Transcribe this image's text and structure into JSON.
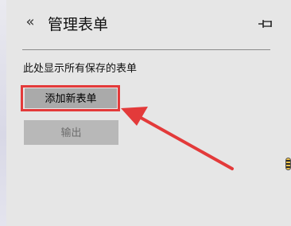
{
  "header": {
    "back_icon": "«",
    "title": "管理表单",
    "pin_icon": "pin-icon"
  },
  "main": {
    "description": "此处显示所有保存的表单",
    "add_button_label": "添加新表单",
    "export_button_label": "输出"
  },
  "colors": {
    "highlight": "#e33a3a",
    "arrow": "#e33a3a",
    "background": "#e6e6e6",
    "button": "#aaaaaa",
    "button_disabled": "#b8b8b8"
  }
}
